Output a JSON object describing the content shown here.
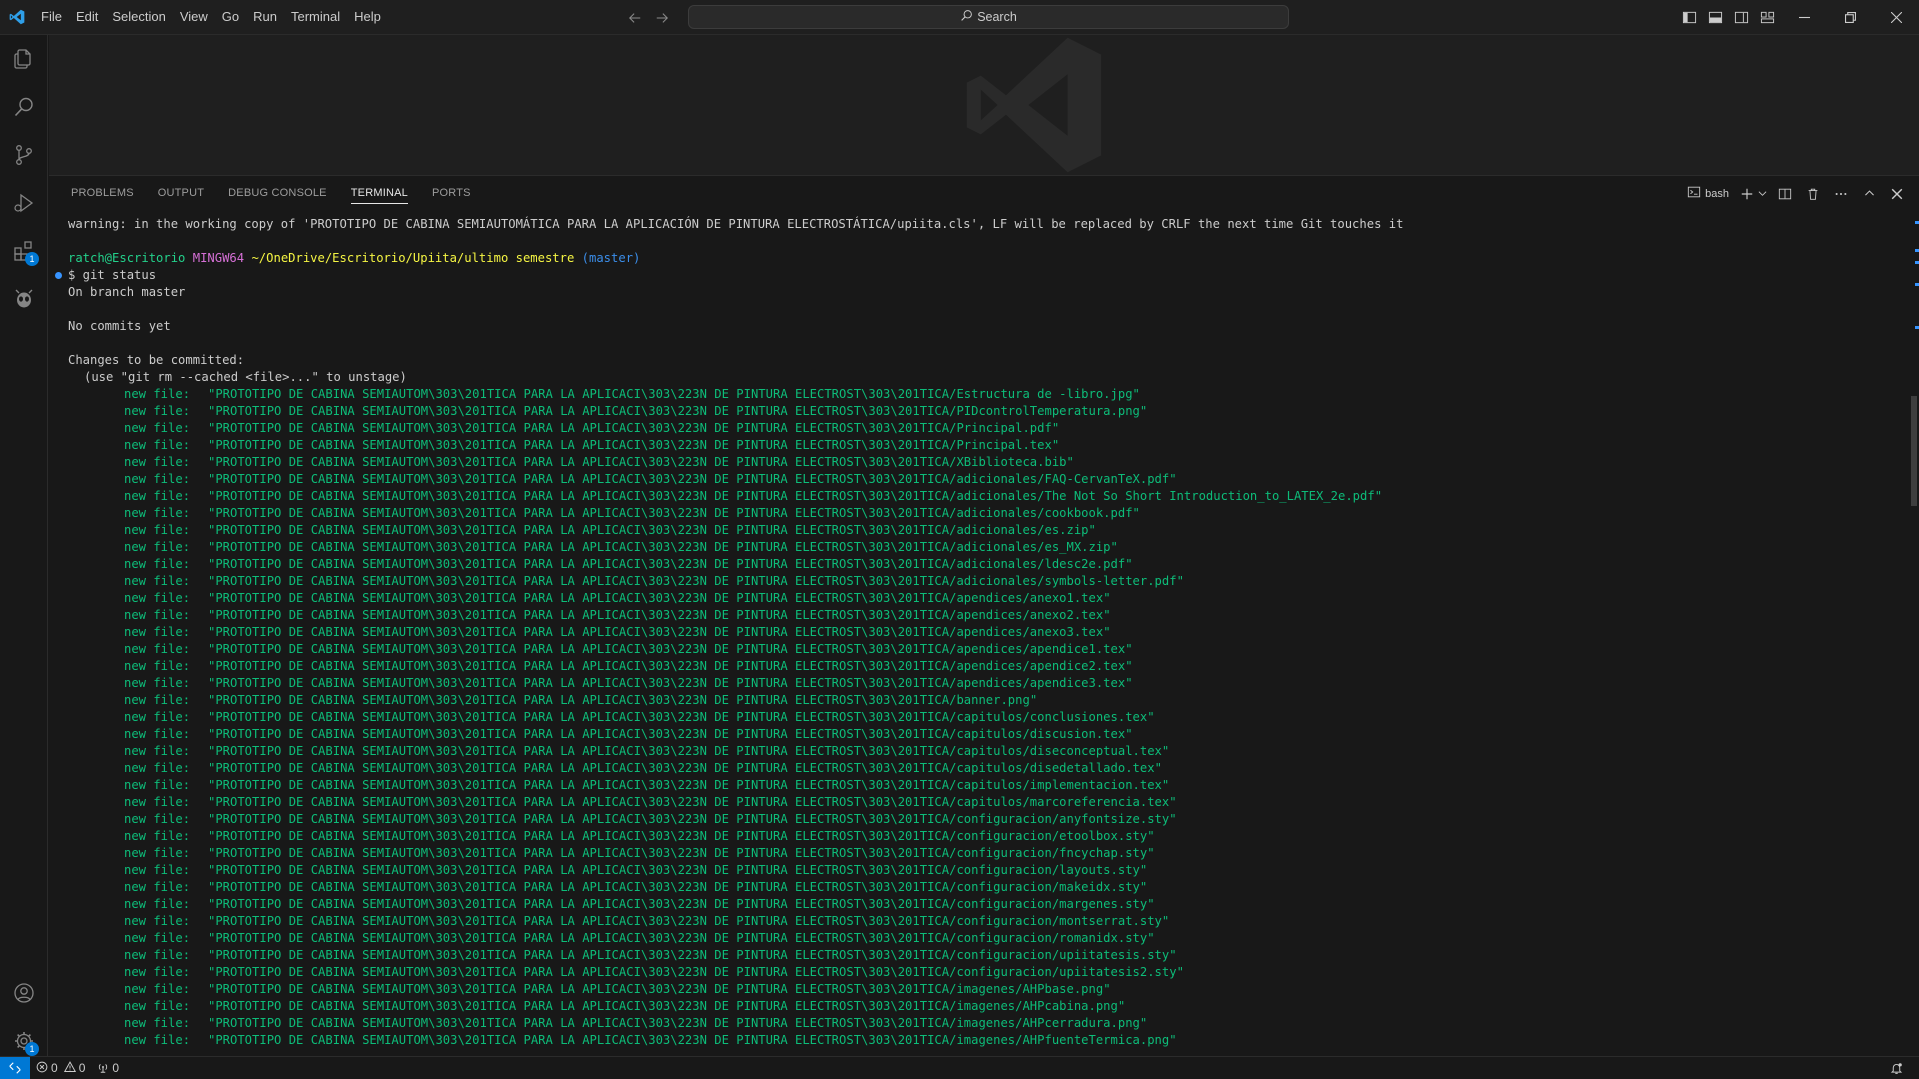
{
  "menu": [
    "File",
    "Edit",
    "Selection",
    "View",
    "Go",
    "Run",
    "Terminal",
    "Help"
  ],
  "search": {
    "label": "Search"
  },
  "activity_badges": {
    "extensions": "1",
    "manage": "1"
  },
  "panel": {
    "tabs": [
      "PROBLEMS",
      "OUTPUT",
      "DEBUG CONSOLE",
      "TERMINAL",
      "PORTS"
    ],
    "active_tab": "TERMINAL",
    "terminal_profile": "bash"
  },
  "terminal": {
    "warning": "warning: in the working copy of 'PROTOTIPO DE CABINA SEMIAUTOMÁTICA PARA LA APLICACIÓN DE PINTURA ELECTROSTÁTICA/upiita.cls', LF will be replaced by CRLF the next time Git touches it",
    "prompt": {
      "user_host": "ratch@Escritorio",
      "env": "MINGW64",
      "path": "~/OneDrive/Escritorio/Upiita/ultimo semestre",
      "branch": "(master)"
    },
    "command": "$ git status",
    "output": {
      "on_branch": "On branch master",
      "no_commits": "No commits yet",
      "changes_header": "Changes to be committed:",
      "hint": "(use \"git rm --cached <file>...\" to unstage)",
      "new_file_label": "new file:",
      "files_prefix": "\"PROTOTIPO DE CABINA SEMIAUTOM\\303\\201TICA PARA LA APLICACI\\303\\223N DE PINTURA ELECTROST\\303\\201TICA/",
      "files": [
        "Estructura de -libro.jpg",
        "PIDcontrolTemperatura.png",
        "Principal.pdf",
        "Principal.tex",
        "XBiblioteca.bib",
        "adicionales/FAQ-CervanTeX.pdf",
        "adicionales/The Not So Short Introduction_to_LATEX_2e.pdf",
        "adicionales/cookbook.pdf",
        "adicionales/es.zip",
        "adicionales/es_MX.zip",
        "adicionales/ldesc2e.pdf",
        "adicionales/symbols-letter.pdf",
        "apendices/anexo1.tex",
        "apendices/anexo2.tex",
        "apendices/anexo3.tex",
        "apendices/apendice1.tex",
        "apendices/apendice2.tex",
        "apendices/apendice3.tex",
        "banner.png",
        "capitulos/conclusiones.tex",
        "capitulos/discusion.tex",
        "capitulos/diseconceptual.tex",
        "capitulos/disedetallado.tex",
        "capitulos/implementacion.tex",
        "capitulos/marcoreferencia.tex",
        "configuracion/anyfontsize.sty",
        "configuracion/etoolbox.sty",
        "configuracion/fncychap.sty",
        "configuracion/layouts.sty",
        "configuracion/makeidx.sty",
        "configuracion/margenes.sty",
        "configuracion/montserrat.sty",
        "configuracion/romanidx.sty",
        "configuracion/upiitatesis.sty",
        "configuracion/upiitatesis2.sty",
        "imagenes/AHPbase.png",
        "imagenes/AHPcabina.png",
        "imagenes/AHPcerradura.png",
        "imagenes/AHPfuenteTermica.png"
      ]
    }
  },
  "status": {
    "errors": "0",
    "warnings": "0",
    "ports": "0"
  },
  "colors": {
    "accent": "#0078d4",
    "terminal_green": "#23d18b",
    "terminal_yellow": "#f5f543",
    "terminal_magenta": "#d670d6",
    "terminal_blue": "#3b8eea",
    "file_green": "#0dbc79"
  }
}
